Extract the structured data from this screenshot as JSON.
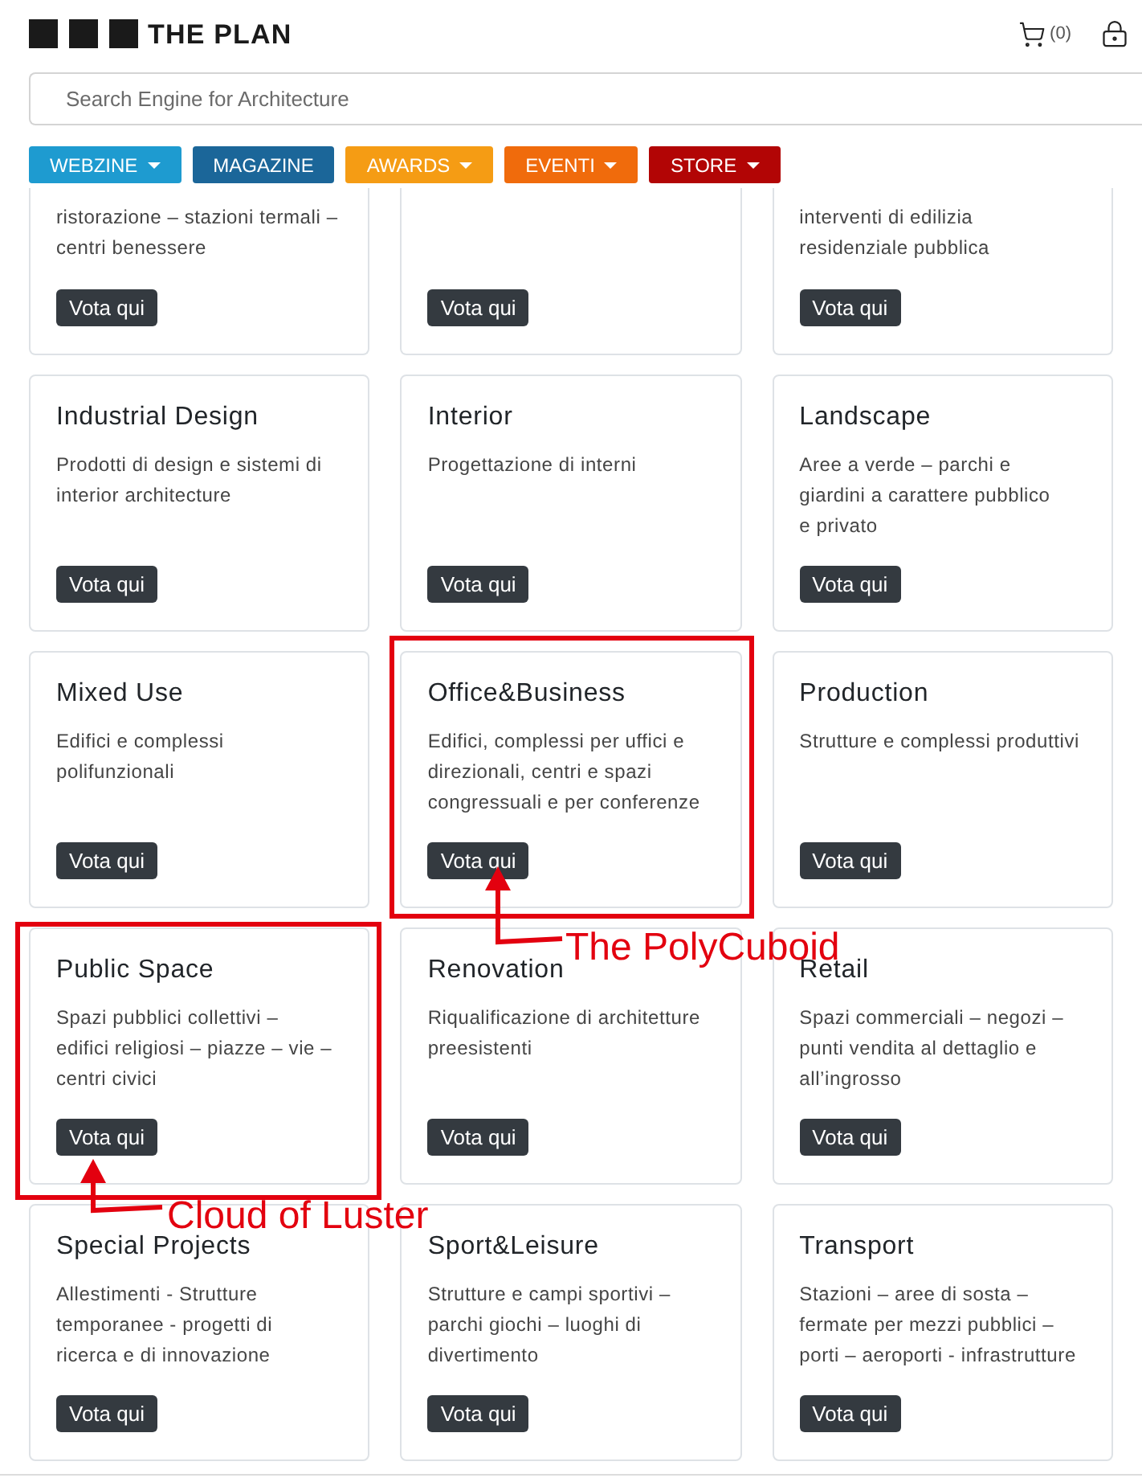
{
  "header": {
    "logo_text": "THE PLAN",
    "cart_count": "(0)"
  },
  "search": {
    "placeholder": "Search Engine for Architecture"
  },
  "nav": [
    {
      "label": "WEBZINE",
      "color": "#1e9bd0",
      "has_menu": true
    },
    {
      "label": "MAGAZINE",
      "color": "#1b6699",
      "has_menu": false
    },
    {
      "label": "AWARDS",
      "color": "#f59c14",
      "has_menu": true
    },
    {
      "label": "EVENTI",
      "color": "#f06b0c",
      "has_menu": true
    },
    {
      "label": "STORE",
      "color": "#b20505",
      "has_menu": true
    }
  ],
  "cards": [
    {
      "kind": "clipped",
      "description": [
        "ristorazione – stazioni termali –",
        "centri benessere"
      ],
      "button": "Vota qui"
    },
    {
      "kind": "clipped",
      "button": "Vota qui"
    },
    {
      "kind": "clipped",
      "description": [
        "interventi di edilizia",
        "residenziale pubblica"
      ],
      "button": "Vota qui"
    },
    {
      "kind": "full",
      "title": "Industrial Design",
      "description": [
        "Prodotti di design e sistemi di",
        "interior architecture"
      ],
      "button": "Vota qui"
    },
    {
      "kind": "full",
      "title": "Interior",
      "description": [
        "Progettazione di interni"
      ],
      "button": "Vota qui"
    },
    {
      "kind": "full",
      "title": "Landscape",
      "description": [
        "Aree a verde – parchi e",
        "giardini a carattere pubblico",
        "e privato"
      ],
      "button": "Vota qui"
    },
    {
      "kind": "full",
      "title": "Mixed Use",
      "description": [
        "Edifici e complessi",
        "polifunzionali"
      ],
      "button": "Vota qui"
    },
    {
      "kind": "full",
      "title": "Office&Business",
      "description": [
        "Edifici, complessi per uffici e",
        "direzionali, centri e spazi",
        "congressuali e per conferenze"
      ],
      "button": "Vota qui"
    },
    {
      "kind": "full",
      "title": "Production",
      "description": [
        "Strutture e complessi produttivi"
      ],
      "button": "Vota qui"
    },
    {
      "kind": "full",
      "title": "Public Space",
      "description": [
        "Spazi pubblici collettivi –",
        "edifici religiosi – piazze – vie –",
        "centri civici"
      ],
      "button": "Vota qui"
    },
    {
      "kind": "full",
      "title": "Renovation",
      "description": [
        "Riqualificazione di architetture",
        "preesistenti"
      ],
      "button": "Vota qui"
    },
    {
      "kind": "full",
      "title": "Retail",
      "description": [
        "Spazi commerciali – negozi –",
        "punti vendita al dettaglio e",
        "all’ingrosso"
      ],
      "button": "Vota qui"
    },
    {
      "kind": "full",
      "title": "Special Projects",
      "description": [
        "Allestimenti - Strutture",
        "temporanee - progetti di",
        "ricerca e di innovazione"
      ],
      "button": "Vota qui"
    },
    {
      "kind": "full",
      "title": "Sport&Leisure",
      "description": [
        "Strutture e campi sportivi –",
        "parchi giochi – luoghi di",
        "divertimento"
      ],
      "button": "Vota qui"
    },
    {
      "kind": "full",
      "title": "Transport",
      "description": [
        "Stazioni – aree di sosta –",
        "fermate per mezzi pubblici –",
        "porti – aeroporti - infrastrutture"
      ],
      "button": "Vota qui"
    }
  ],
  "annotations": [
    {
      "label": "The PolyCuboid"
    },
    {
      "label": "Cloud of Luster"
    }
  ]
}
